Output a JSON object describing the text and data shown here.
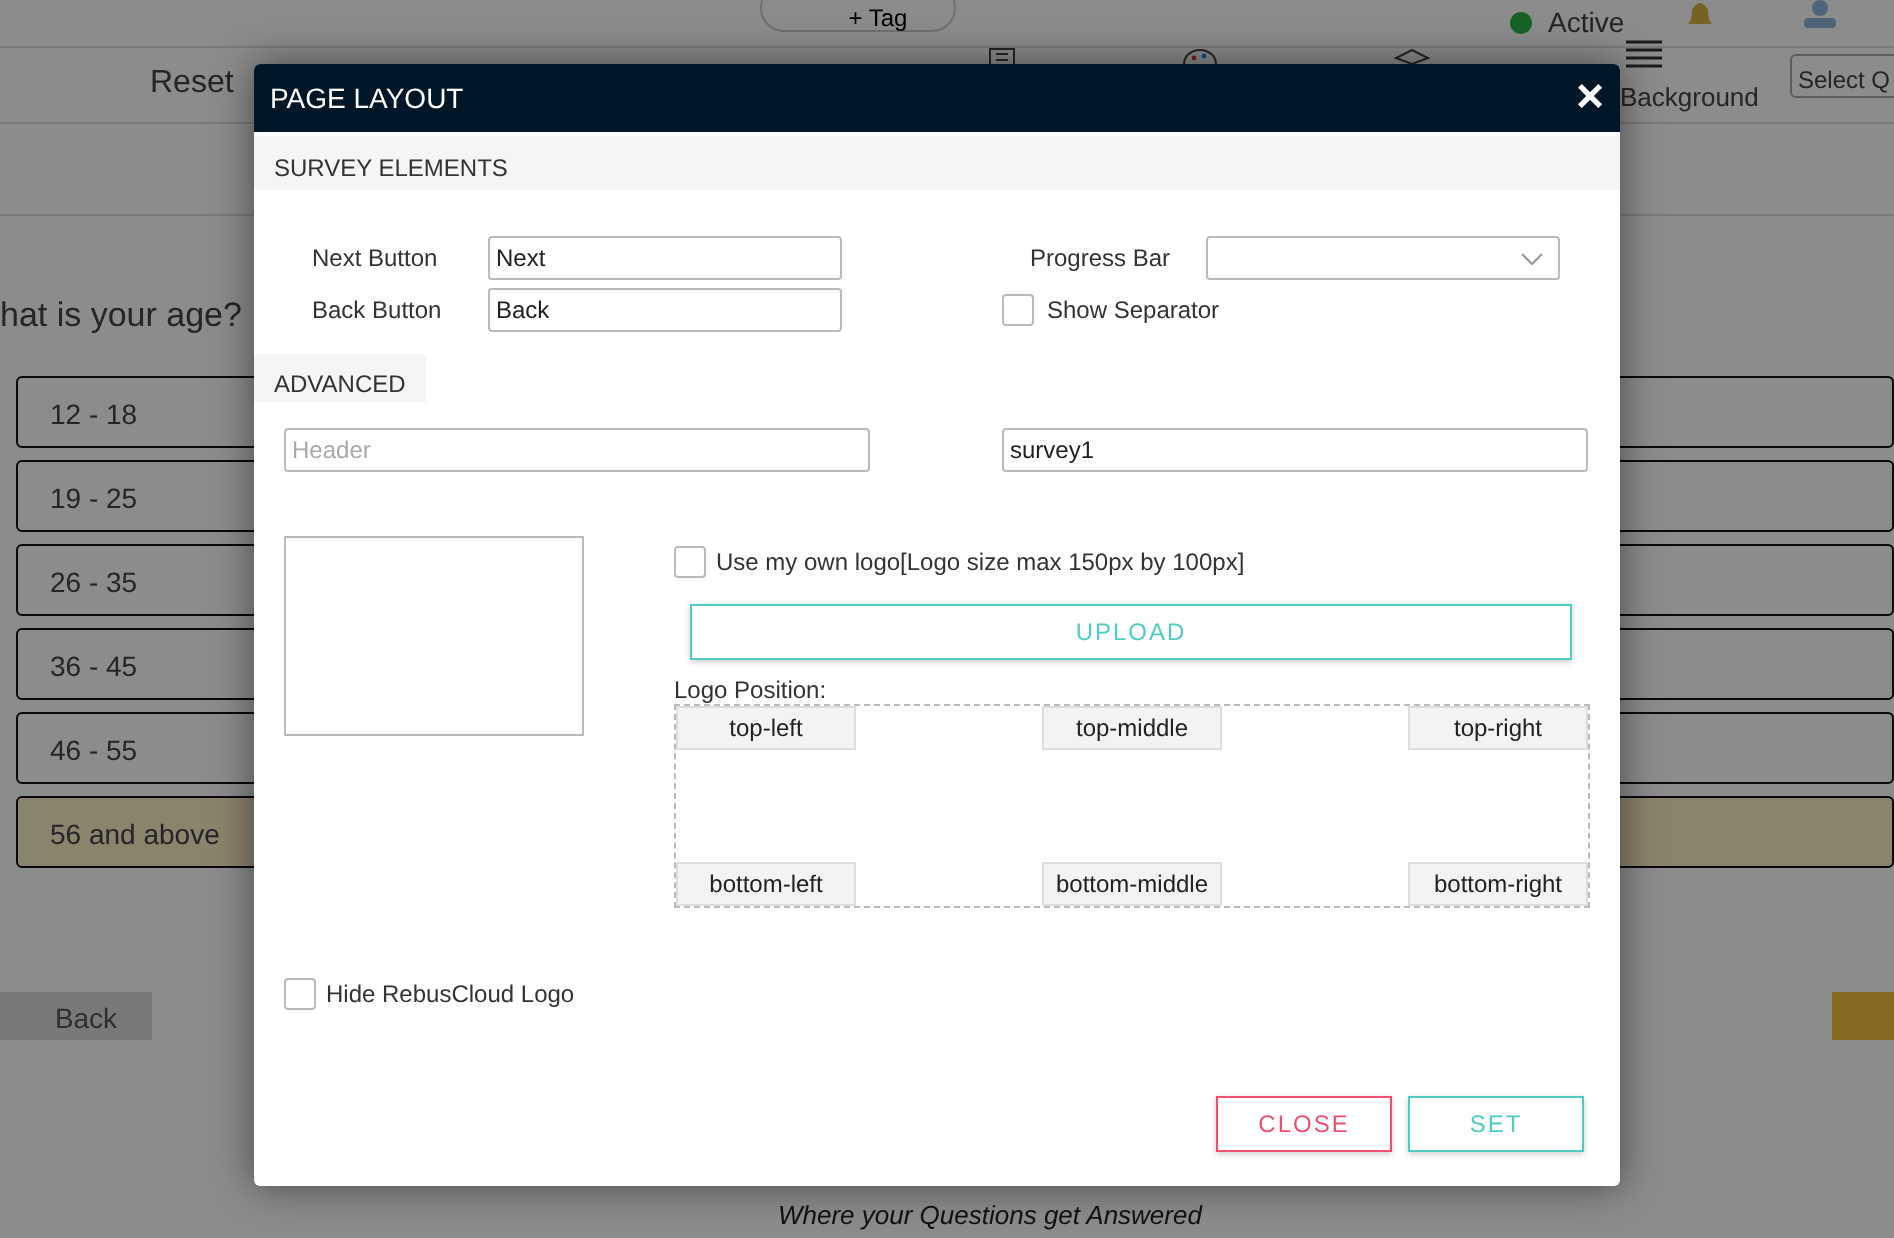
{
  "background": {
    "tag_button": "+ Tag",
    "status": "Active",
    "reset_label": "Reset",
    "background_label": "Background",
    "select_placeholder": "Select Q",
    "question": "hat is your age?",
    "options": [
      {
        "label": "12 - 18",
        "selected": false
      },
      {
        "label": "19 - 25",
        "selected": false
      },
      {
        "label": "26 - 35",
        "selected": false
      },
      {
        "label": "36 - 45",
        "selected": false
      },
      {
        "label": "46 - 55",
        "selected": false
      },
      {
        "label": "56 and above",
        "selected": true
      }
    ],
    "back_button": "Back",
    "footer": "Where your Questions get Answered"
  },
  "modal": {
    "title": "PAGE LAYOUT",
    "close": "×",
    "survey_elements": {
      "heading": "SURVEY ELEMENTS",
      "next_button": {
        "label": "Next Button",
        "value": "Next"
      },
      "back_button": {
        "label": "Back Button",
        "value": "Back"
      },
      "progress_bar": {
        "label": "Progress Bar"
      },
      "show_separator": {
        "label": "Show Separator",
        "checked": false
      }
    },
    "advanced": {
      "heading": "ADVANCED",
      "header_field": {
        "placeholder": "Header"
      },
      "name_field": {
        "value": "survey1"
      },
      "own_logo": {
        "label": "Use my own logo[Logo size max 150px by 100px]",
        "checked": false
      },
      "upload_button": "UPLOAD",
      "logo_position": {
        "label": "Logo Position:",
        "positions": [
          "top-left",
          "top-middle",
          "top-right",
          "bottom-left",
          "bottom-middle",
          "bottom-right"
        ]
      },
      "hide_logo": {
        "label": "Hide RebusCloud Logo",
        "checked": false
      }
    },
    "buttons": [
      {
        "label": "CLOSE",
        "kind": "cancel"
      },
      {
        "label": "SET",
        "kind": "confirm"
      }
    ]
  }
}
